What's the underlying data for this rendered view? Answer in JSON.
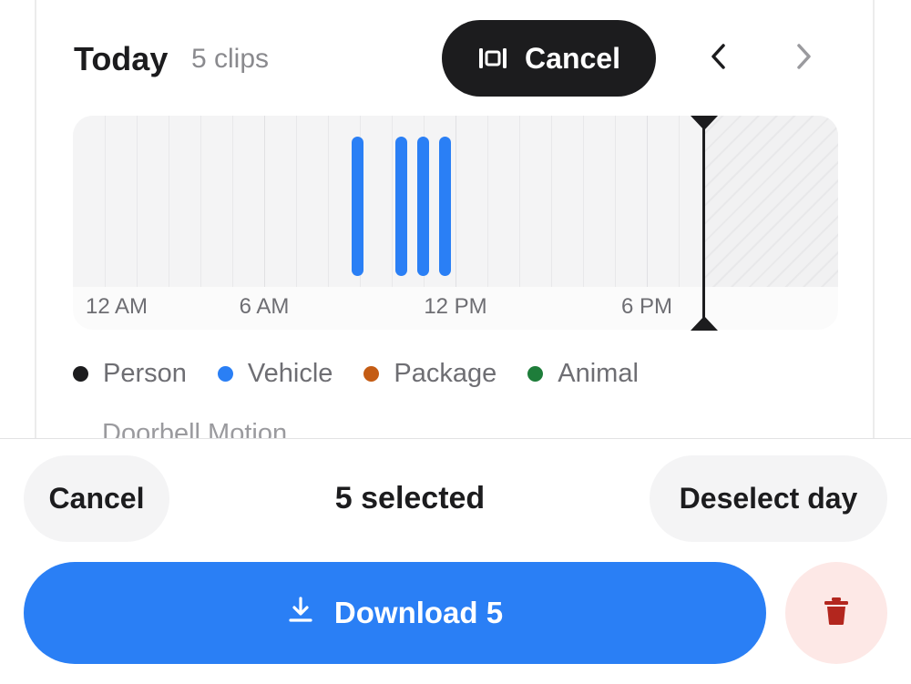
{
  "header": {
    "title": "Today",
    "clip_count": "5 clips",
    "cancel_pill_label": "Cancel"
  },
  "timeline": {
    "tick_labels": [
      "12 AM",
      "6 AM",
      "12 PM",
      "6 PM"
    ],
    "clips": [
      {
        "type": "Vehicle",
        "color": "#2a7ff5"
      },
      {
        "type": "Vehicle",
        "color": "#2a7ff5"
      },
      {
        "type": "Vehicle",
        "color": "#2a7ff5"
      },
      {
        "type": "Vehicle",
        "color": "#2a7ff5"
      }
    ],
    "now_marker_color": "#1c1c1e"
  },
  "legend": [
    {
      "label": "Person",
      "color": "#1c1c1e"
    },
    {
      "label": "Vehicle",
      "color": "#2a7ff5"
    },
    {
      "label": "Package",
      "color": "#c45c14"
    },
    {
      "label": "Animal",
      "color": "#1e7d3a"
    }
  ],
  "legend_second_row": "Doorbell    Motion",
  "selection_bar": {
    "cancel_label": "Cancel",
    "selected_text": "5 selected",
    "deselect_label": "Deselect day",
    "download_label": "Download 5"
  },
  "colors": {
    "accent": "#2a7ff5",
    "delete": "#b3261e",
    "delete_bg": "#fde8e6"
  },
  "icons": {
    "cancel_pill": "select-range-icon",
    "prev": "chevron-left-icon",
    "next": "chevron-right-icon",
    "download": "download-icon",
    "delete": "trash-icon"
  }
}
